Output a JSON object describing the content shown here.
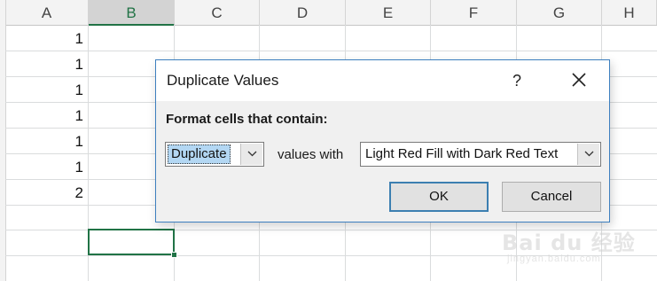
{
  "sheet": {
    "columns": [
      "A",
      "B",
      "C",
      "D",
      "E",
      "F",
      "G",
      "H"
    ],
    "selected_column": "B",
    "column_a_values": [
      "1",
      "1",
      "1",
      "1",
      "1",
      "1",
      "2"
    ],
    "active_cell": "B10"
  },
  "dialog": {
    "title": "Duplicate Values",
    "help_label": "?",
    "prompt": "Format cells that contain:",
    "type_select": {
      "value": "Duplicate"
    },
    "values_with_label": "values with",
    "format_select": {
      "value": "Light Red Fill with Dark Red Text"
    },
    "ok_label": "OK",
    "cancel_label": "Cancel"
  },
  "watermark": {
    "text": "Bai du 经验",
    "sub": "jingyan.baidu.com"
  },
  "colors": {
    "excel_green": "#217346",
    "dialog_border": "#3d7fbf",
    "highlight": "#b3d7f3"
  }
}
